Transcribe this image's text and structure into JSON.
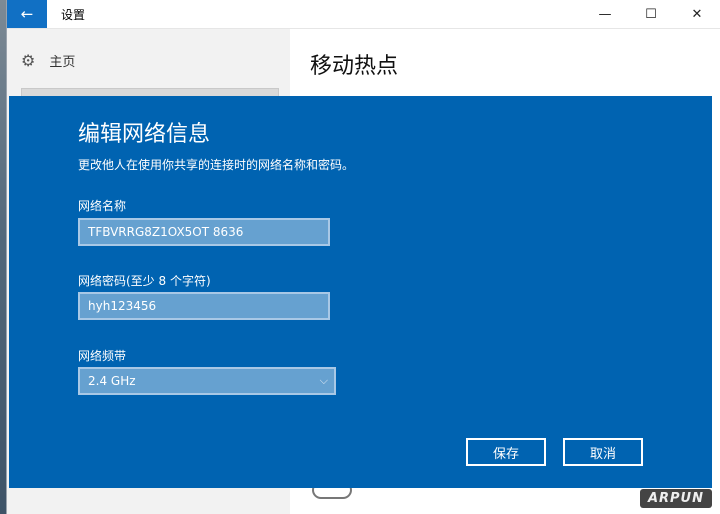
{
  "window": {
    "title": "设置",
    "back_icon": "←",
    "minimize_icon": "—",
    "maximize_icon": "☐",
    "close_icon": "✕"
  },
  "sidebar": {
    "home_label": "主页",
    "gear_icon": "⚙"
  },
  "main": {
    "title": "移动热点"
  },
  "dialog": {
    "title": "编辑网络信息",
    "description": "更改他人在使用你共享的连接时的网络名称和密码。",
    "network_name_label": "网络名称",
    "network_name_value": "TFBVRRG8Z1OX5OT 8636",
    "password_label": "网络密码(至少 8 个字符)",
    "password_value": "hyh123456",
    "band_label": "网络频带",
    "band_value": "2.4 GHz",
    "chevron_icon": "⌵",
    "save_label": "保存",
    "cancel_label": "取消"
  },
  "watermark": {
    "logo_text": "ARPUN"
  },
  "colors": {
    "dialog_bg": "#0063b1",
    "accent": "#1170c4"
  }
}
